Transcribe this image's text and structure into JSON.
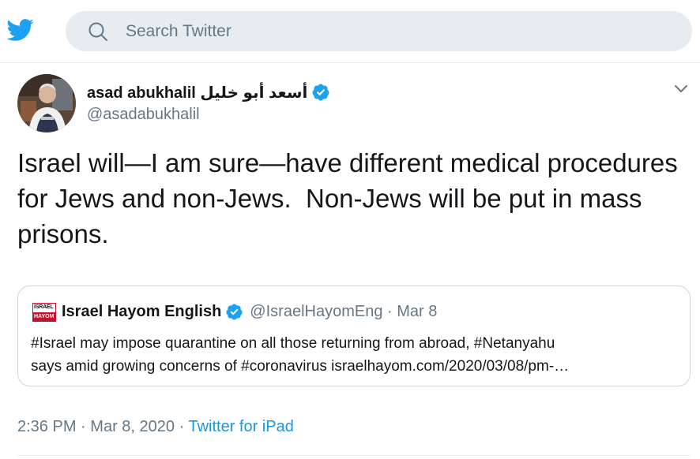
{
  "search": {
    "placeholder": "Search Twitter"
  },
  "tweet": {
    "display_name": "asad abukhalil أسعد أبو خليل",
    "handle": "@asadabukhalil",
    "text": "Israel will—I am sure—have different medical procedures for Jews and non-Jews.  Non-Jews will be put in mass prisons.",
    "time": "2:36 PM",
    "separator": "·",
    "date": "Mar 8, 2020",
    "source": "Twitter for iPad"
  },
  "quote": {
    "logo_top": "ISRAEL",
    "logo_bottom": "HAYOM",
    "display_name": "Israel Hayom English",
    "handle": "@IsraelHayomEng",
    "separator": "·",
    "date": "Mar 8",
    "line1": "#Israel may impose quarantine on all those returning from abroad, #Netanyahu",
    "line2": " says amid growing concerns of #coronavirus  israelhayom.com/2020/03/08/pm-…"
  },
  "colors": {
    "brand": "#1da1f2",
    "link": "#1b95e0",
    "secondary_text": "#657786",
    "verified": "#1da1f2",
    "search_bg": "#e6ecf0"
  },
  "icons": {
    "logo": "twitter-bird-icon",
    "search": "search-icon",
    "verified": "verified-badge-icon",
    "caret": "chevron-down-icon"
  }
}
